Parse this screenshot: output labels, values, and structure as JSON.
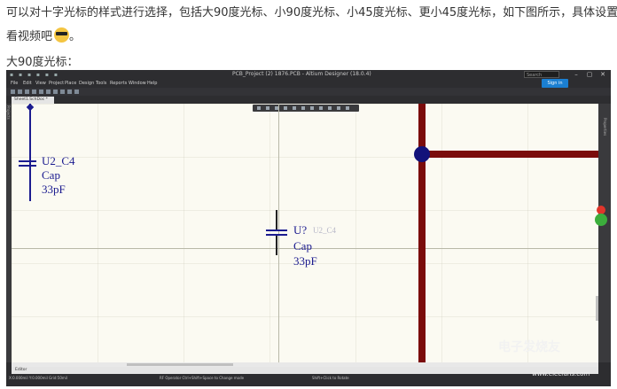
{
  "article": {
    "line1": "可以对十字光标的样式进行选择，包括大90度光标、小90度光标、小45度光标、更小45度光标，如下图所示，具体设置请",
    "line2": "看视频吧",
    "line3": "大90度光标："
  },
  "app": {
    "title": "PCB_Project (2) 1876.PCB - Altium Designer (18.0.4)",
    "search_placeholder": "Search",
    "signin": "Sign in",
    "menu": [
      "File",
      "Edit",
      "View",
      "Project",
      "Place",
      "Design",
      "Tools",
      "Reports",
      "Window",
      "Help"
    ],
    "doc_tab": "Sheet1.SchDoc *",
    "left_panel": "Projects",
    "right_panel": "Properties",
    "sheet_tab": "Editor",
    "status": {
      "coords": "X:0.000mil Y:0.000mil  Grid:50mil",
      "mode": "RF Operator   Ctrl+Shift+Space to Change mode",
      "panels": "Shift+Click to Rotate"
    }
  },
  "schematic": {
    "comp1": {
      "ref": "U2_C4",
      "name": "Cap",
      "value": "33pF"
    },
    "comp2": {
      "ref": "U?",
      "ghost": "U2_C4",
      "name": "Cap",
      "value": "33pF"
    },
    "colors": {
      "wire": "#1b1b8f",
      "bus": "#7b0c0c",
      "node": "#12127a",
      "sheet": "#fbfaf2"
    }
  },
  "icons": [
    "quick-access-icon",
    "chevron-down-icon",
    "minimize-icon",
    "maximize-icon",
    "close-icon",
    "gear-icon",
    "filter-icon"
  ],
  "watermark": {
    "brand": "电子发烧友",
    "url": "www.elecfans.com"
  }
}
